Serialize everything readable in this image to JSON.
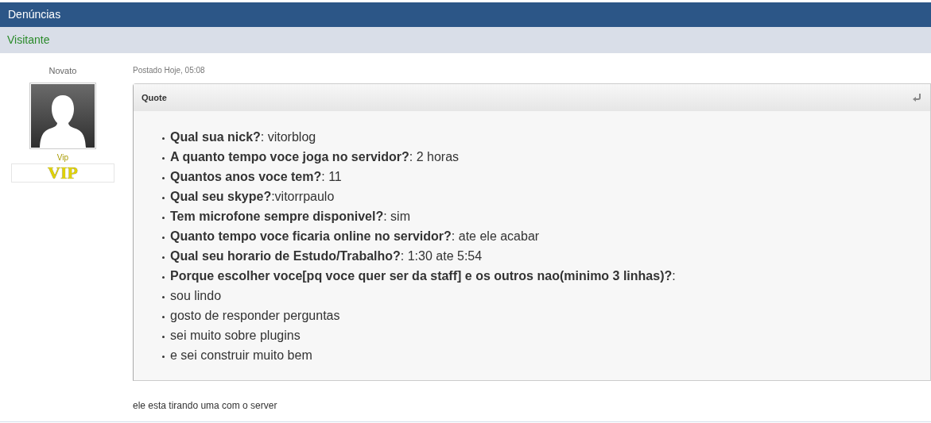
{
  "header": {
    "title": "Denúncias"
  },
  "author": {
    "name": "Visitante",
    "rank": "Novato",
    "group": "Vip",
    "badge": "VIP"
  },
  "post": {
    "date": "Postado Hoje, 05:08",
    "quote": {
      "title": "Quote",
      "items": [
        {
          "text": "**Qual sua nick?**: vitorblog"
        },
        {
          "text": "**A quanto tempo voce joga no servidor?**: 2 horas"
        },
        {
          "text": "**Quantos anos voce tem?**: 11"
        },
        {
          "text": "**Qual seu skype?**:vitorrpaulo"
        },
        {
          "text": "**Tem microfone sempre disponivel?**: sim"
        },
        {
          "text": "**Quanto tempo voce ficaria online no servidor?**: ate ele acabar"
        },
        {
          "text": "**Qual seu horario de Estudo/Trabalho?**: 1:30 ate 5:54"
        },
        {
          "text": "**Porque escolher voce[pq voce quer ser da staff] e os outros nao(minimo 3 linhas)?**:"
        },
        {
          "text": "sou lindo"
        },
        {
          "text": "gosto de responder perguntas"
        },
        {
          "text": "sei muito sobre plugins"
        },
        {
          "text": "e sei construir muito bem"
        }
      ]
    },
    "body": "ele esta tirando uma com o server"
  }
}
